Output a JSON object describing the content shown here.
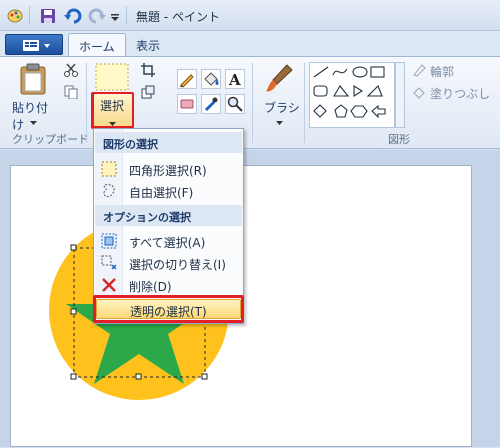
{
  "window": {
    "title": "無題 - ペイント"
  },
  "tabs": [
    {
      "label": "ホーム",
      "active": true
    },
    {
      "label": "表示",
      "active": false
    }
  ],
  "ribbon": {
    "paste_label": "貼り付け",
    "select_label": "選択",
    "brush_label": "ブラシ",
    "outline_label": "輪郭",
    "fill_label": "塗りつぶし",
    "groups": {
      "clipboard": "クリップボード",
      "shapes": "図形"
    }
  },
  "select_menu": {
    "section_shape": "図形の選択",
    "section_options": "オプションの選択",
    "items": [
      {
        "label": "四角形選択(R)",
        "icon": "rectangle-select-icon"
      },
      {
        "label": "自由選択(F)",
        "icon": "free-form-select-icon"
      },
      {
        "label": "すべて選択(A)",
        "icon": "select-all-icon"
      },
      {
        "label": "選択の切り替え(I)",
        "icon": "invert-selection-icon"
      },
      {
        "label": "削除(D)",
        "icon": "delete-icon"
      },
      {
        "label": "透明の選択(T)",
        "icon": "",
        "highlighted": true
      }
    ]
  },
  "colors": {
    "accent_red": "#e31e24",
    "circle_yellow": "#ffc21d",
    "star_green": "#2aa84a"
  }
}
